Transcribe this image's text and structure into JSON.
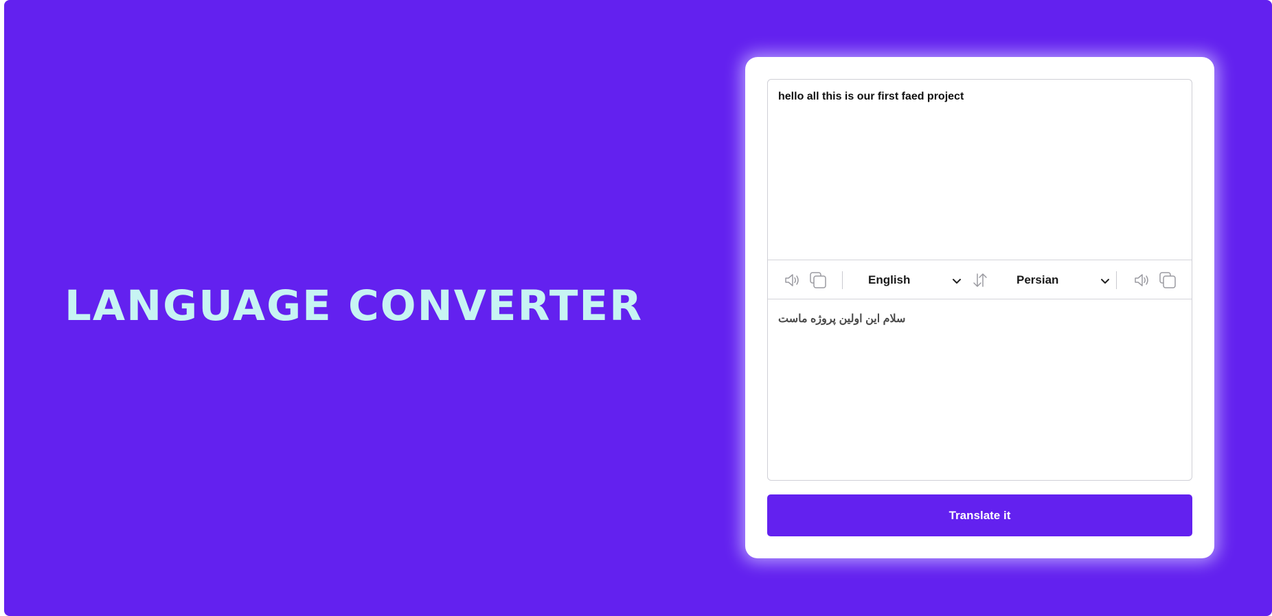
{
  "hero": {
    "title": "LANGUAGE CONVERTER"
  },
  "translator": {
    "source_text": "hello all this is our first faed project",
    "target_text": "سلام این اولین پروژه ماست",
    "source_language": "English",
    "target_language": "Persian",
    "translate_button_label": "Translate it"
  },
  "icons": {
    "source_speak": "speaker-icon",
    "source_copy": "copy-icon",
    "swap": "swap-arrows-icon",
    "target_speak": "speaker-icon",
    "target_copy": "copy-icon",
    "dropdown": "chevron-down-icon"
  },
  "colors": {
    "background": "#6321ef",
    "title": "#c7f4f3",
    "button": "#6321ef",
    "card": "#ffffff"
  }
}
